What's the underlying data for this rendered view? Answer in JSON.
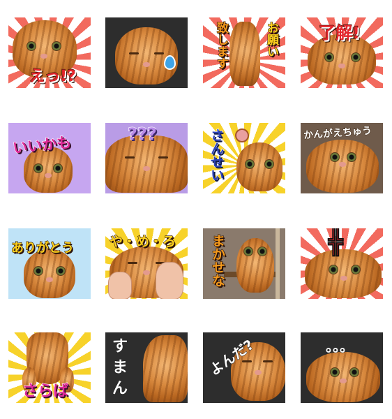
{
  "stickers": [
    {
      "caption": "えっ!?"
    },
    {
      "caption": ""
    },
    {
      "caption_left": "致します",
      "caption_right": "お願い"
    },
    {
      "caption": "了解!"
    },
    {
      "caption": "いいかも"
    },
    {
      "caption": "???"
    },
    {
      "caption": "さんせい"
    },
    {
      "caption": "かんがえちゅう"
    },
    {
      "caption": "ありがとう"
    },
    {
      "caption": "や・め・ろ"
    },
    {
      "caption": "まかせな"
    },
    {
      "caption": ""
    },
    {
      "caption": "さらば"
    },
    {
      "caption": "すまん"
    },
    {
      "caption": "よんだ?"
    },
    {
      "caption": "。。。"
    }
  ]
}
